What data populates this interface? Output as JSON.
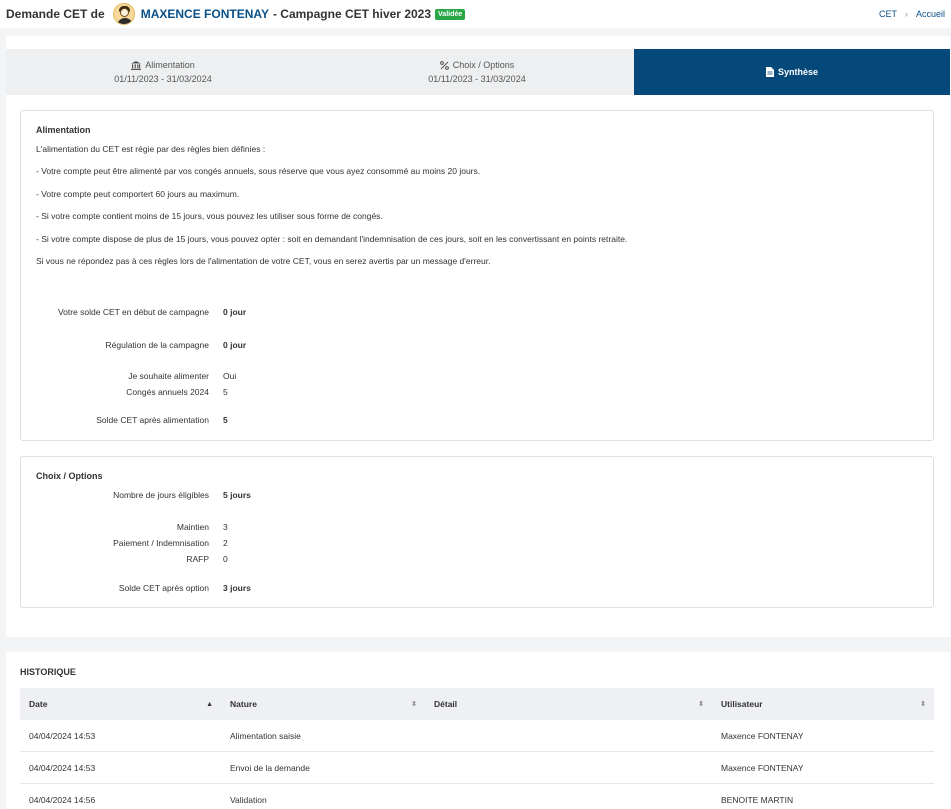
{
  "header": {
    "prefix": "Demande CET de",
    "user_name": "MAXENCE FONTENAY",
    "campaign": "- Campagne CET hiver 2023",
    "status_badge": "Validée",
    "breadcrumb": [
      "CET",
      "Accueil"
    ]
  },
  "tabs": [
    {
      "label": "Alimentation",
      "dates": "01/11/2023 - 31/03/2024",
      "icon": "bank-icon"
    },
    {
      "label": "Choix / Options",
      "dates": "01/11/2023 - 31/03/2024",
      "icon": "percent-icon"
    },
    {
      "label": "Synthèse",
      "icon": "document-icon",
      "active": true
    }
  ],
  "alimentation": {
    "title": "Alimentation",
    "paragraphs": [
      "L'alimentation du CET est régie par des règles bien définies :",
      "- Votre compte peut être alimenté par vos congés annuels, sous réserve que vous ayez consommé au moins 20 jours.",
      "- Votre compte peut comportert 60 jours au maximum.",
      "- Si votre compte contient moins de 15 jours, vous pouvez les utiliser sous forme de congés.",
      "- Si votre compte dispose de plus de 15 jours, vous pouvez opter : soit en demandant l'indemnisation de ces jours, soit en les convertissant en points retraite.",
      "Si vous ne répondez pas à ces règles lors de l'alimentation de votre CET, vous en serez avertis par un message d'erreur."
    ],
    "rows": [
      {
        "label": "Votre solde CET en début de campagne",
        "value": "0 jour",
        "bold": true
      },
      {
        "label": "Régulation de la campagne",
        "value": "0 jour",
        "bold": true
      },
      {
        "label": "Je souhaite alimenter",
        "value": "Oui",
        "bold": false
      },
      {
        "label": "Congés annuels 2024",
        "value": "5",
        "bold": false
      },
      {
        "label": "Solde CET après alimentation",
        "value": "5",
        "bold": true
      }
    ]
  },
  "choix": {
    "title": "Choix / Options",
    "rows": [
      {
        "label": "Nombre de jours éligibles",
        "value": "5 jours",
        "bold": true
      },
      {
        "label": "Maintien",
        "value": "3",
        "bold": false
      },
      {
        "label": "Paiement / Indemnisation",
        "value": "2",
        "bold": false
      },
      {
        "label": "RAFP",
        "value": "0",
        "bold": false
      },
      {
        "label": "Solde CET après option",
        "value": "3 jours",
        "bold": true
      }
    ]
  },
  "historique": {
    "title": "HISTORIQUE",
    "columns": [
      "Date",
      "Nature",
      "Détail",
      "Utilisateur"
    ],
    "rows": [
      [
        "04/04/2024 14:53",
        "Alimentation saisie",
        "",
        "Maxence FONTENAY"
      ],
      [
        "04/04/2024 14:53",
        "Envoi de la demande",
        "",
        "Maxence FONTENAY"
      ],
      [
        "04/04/2024 14:56",
        "Validation",
        "",
        "BENOITE MARTIN"
      ]
    ]
  },
  "colors": {
    "primary": "#05497b",
    "link": "#0a5088",
    "badge": "#29a745"
  }
}
